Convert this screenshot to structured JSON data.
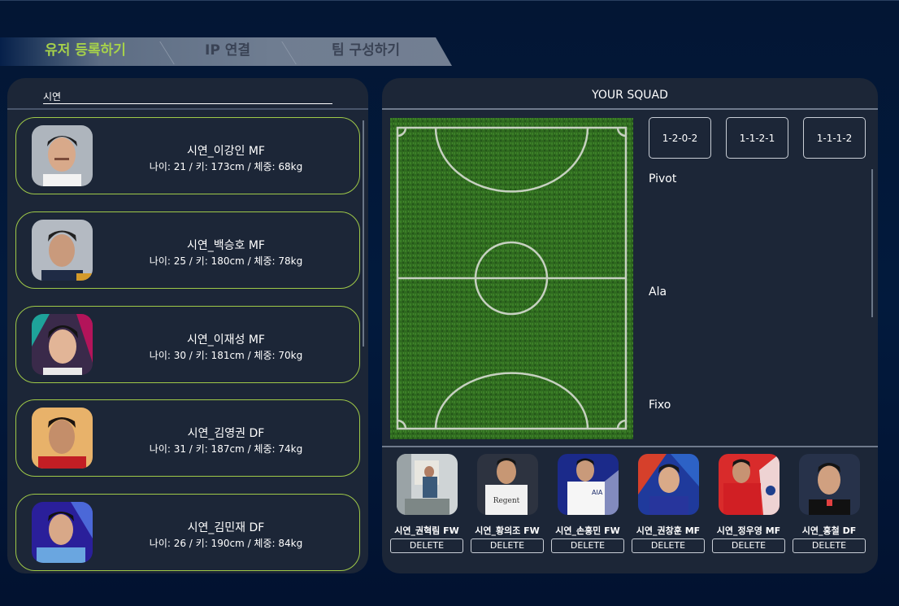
{
  "steps": [
    "유저 등록하기",
    "IP 연결",
    "팀 구성하기"
  ],
  "colors": {
    "active_step": "#a6d14b",
    "inactive_step": "#3a4355",
    "card_border": "#9fc948",
    "panel": "#1c2637",
    "pitch": "#2f6a1f"
  },
  "search": {
    "value": "시연"
  },
  "players": [
    {
      "name": "시연_이강인 MF",
      "stats": "나이: 21 / 키: 173cm / 체중: 68kg"
    },
    {
      "name": "시연_백승호 MF",
      "stats": "나이: 25 / 키: 180cm / 체중: 78kg"
    },
    {
      "name": "시연_이재성 MF",
      "stats": "나이: 30 / 키: 181cm / 체중: 70kg"
    },
    {
      "name": "시연_김영권 DF",
      "stats": "나이: 31 / 키: 187cm / 체중: 74kg"
    },
    {
      "name": "시연_김민재 DF",
      "stats": "나이: 26 / 키: 190cm / 체중: 84kg"
    }
  ],
  "squad": {
    "title": "YOUR SQUAD",
    "formations": [
      "1-2-0-2",
      "1-1-2-1",
      "1-1-1-2"
    ],
    "positions": [
      "Pivot",
      "Ala",
      "Fixo"
    ],
    "members": [
      {
        "name": "시연_권혁림 FW",
        "delete": "DELETE"
      },
      {
        "name": "시연_황의조 FW",
        "delete": "DELETE"
      },
      {
        "name": "시연_손흥민 FW",
        "delete": "DELETE"
      },
      {
        "name": "시연_권창훈 MF",
        "delete": "DELETE"
      },
      {
        "name": "시연_정우영 MF",
        "delete": "DELETE"
      },
      {
        "name": "시연_홍철 DF",
        "delete": "DELETE"
      }
    ]
  }
}
